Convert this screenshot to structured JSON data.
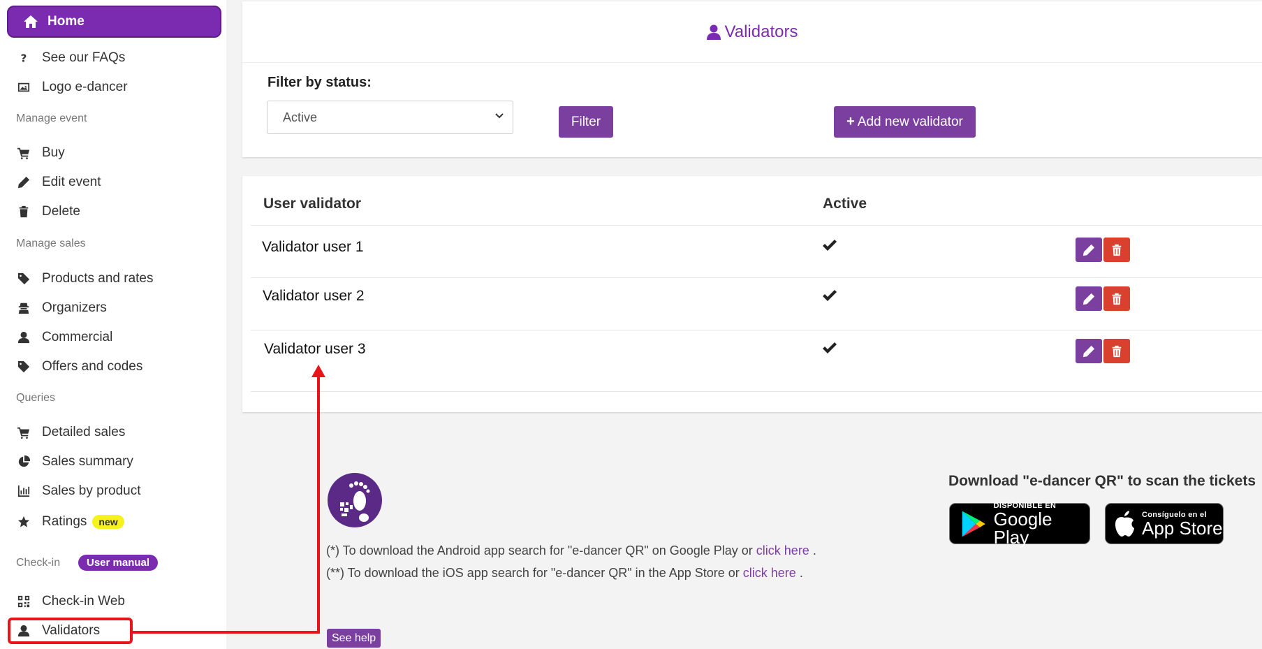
{
  "sidebar": {
    "home": "Home",
    "items_top": [
      {
        "label": "See our FAQs",
        "icon": "question-icon"
      },
      {
        "label": "Logo e-dancer",
        "icon": "image-icon"
      }
    ],
    "section_manage_event": "Manage event",
    "items_event": [
      {
        "label": "Buy",
        "icon": "cart-icon"
      },
      {
        "label": "Edit event",
        "icon": "pencil-icon"
      },
      {
        "label": "Delete",
        "icon": "trash-icon"
      }
    ],
    "section_manage_sales": "Manage sales",
    "items_sales": [
      {
        "label": "Products and rates",
        "icon": "tickets-icon"
      },
      {
        "label": "Organizers",
        "icon": "spy-icon"
      },
      {
        "label": "Commercial",
        "icon": "user-icon"
      },
      {
        "label": "Offers and codes",
        "icon": "tag-icon"
      }
    ],
    "section_queries": "Queries",
    "items_queries": [
      {
        "label": "Detailed sales",
        "icon": "cart-icon"
      },
      {
        "label": "Sales summary",
        "icon": "pie-chart-icon"
      },
      {
        "label": "Sales by product",
        "icon": "bar-chart-icon"
      },
      {
        "label": "Ratings",
        "icon": "star-icon",
        "badge": "new"
      }
    ],
    "section_checkin": "Check-in",
    "user_manual": "User manual",
    "items_checkin": [
      {
        "label": "Check-in Web",
        "icon": "qrcode-icon"
      },
      {
        "label": "Validators",
        "icon": "user-icon"
      }
    ]
  },
  "header": {
    "title": "Validators"
  },
  "filter": {
    "label": "Filter by status:",
    "selected": "Active",
    "filter_button": "Filter",
    "add_button": "Add new validator"
  },
  "table": {
    "columns": [
      "User validator",
      "Active"
    ],
    "rows": [
      {
        "user": "Validator user 1",
        "active": true
      },
      {
        "user": "Validator user 2",
        "active": true
      },
      {
        "user": "Validator user 3",
        "active": true
      }
    ]
  },
  "footer": {
    "note_android_prefix": "(*) To download the Android app search for \"e-dancer QR\" on Google Play or ",
    "note_ios_prefix": "(**) To download the iOS app search for \"e-dancer QR\" in the App Store or ",
    "click_here": "click here",
    "period": ".",
    "see_help": "See help",
    "download_title": "Download \"e-dancer QR\" to scan the tickets",
    "google_small": "DISPONIBLE EN",
    "google_big": "Google Play",
    "apple_small": "Consíguelo en el",
    "apple_big": "App Store"
  },
  "colors": {
    "brand_purple": "#7b2bb0",
    "button_purple": "#7b3fa0",
    "delete_red": "#d9412e",
    "annotation_red": "#e8141c",
    "badge_yellow": "#f5f21d"
  }
}
